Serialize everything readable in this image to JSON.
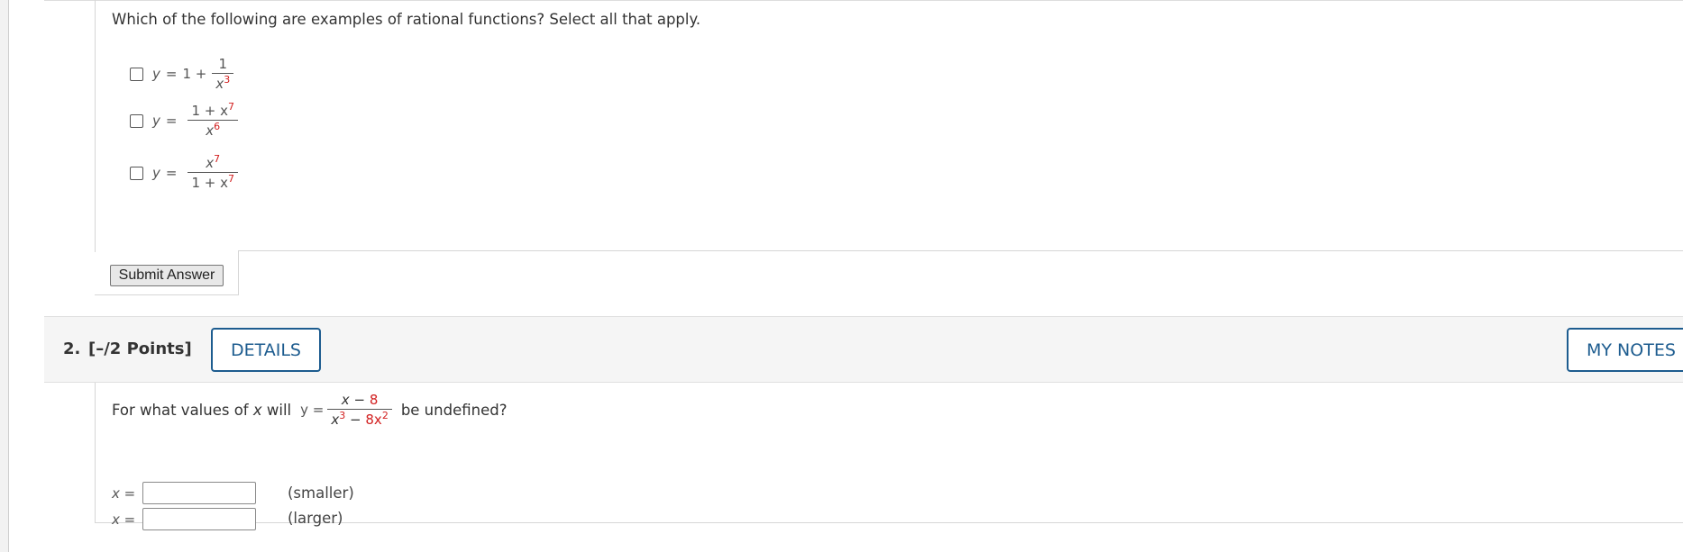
{
  "question1": {
    "prompt": "Which of the following are examples of rational functions? Select all that apply.",
    "options": [
      {
        "lhs": "y",
        "eq": "=",
        "prefix": "1 +",
        "numerator": "1",
        "denominator_base": "x",
        "denominator_exp": "3"
      },
      {
        "lhs": "y",
        "eq": "=",
        "numerator_base": "1 + x",
        "numerator_exp": "7",
        "denominator_base": "x",
        "denominator_exp": "6"
      },
      {
        "lhs": "y",
        "eq": "=",
        "numerator_base": "x",
        "numerator_exp": "7",
        "denominator_base": "1 + x",
        "denominator_exp": "7"
      }
    ],
    "submit_label": "Submit Answer"
  },
  "question2": {
    "number": "2.",
    "points": "[–/2 Points]",
    "details_label": "DETAILS",
    "notes_label": "MY NOTES",
    "prompt_before": "For what values of",
    "prompt_var": "x",
    "prompt_mid": "will",
    "func_lhs": "y =",
    "numerator_x": "x",
    "numerator_rest": "− ",
    "numerator_const": "8",
    "denominator_x": "x",
    "denominator_exp1": "3",
    "denominator_minus": "−",
    "denominator_coef": "8x",
    "denominator_exp2": "2",
    "prompt_after": "be undefined?",
    "answers": [
      {
        "label": "x =",
        "value": "",
        "hint": "(smaller)"
      },
      {
        "label": "x =",
        "value": "",
        "hint": "(larger)"
      }
    ]
  },
  "colors": {
    "accent": "#1d5c8f",
    "exponent": "#d22020"
  }
}
